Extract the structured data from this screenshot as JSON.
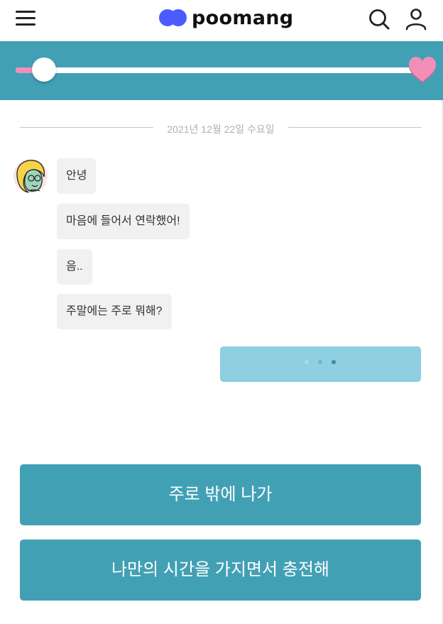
{
  "header": {
    "logo_text": "poomang",
    "logo_color": "#4a5cff",
    "menu_icon": "hamburger-menu-icon",
    "search_icon": "search-icon",
    "user_icon": "user-icon"
  },
  "progress": {
    "value": 0.07,
    "track_color": "#ffffff",
    "fill_color": "#f28eb8",
    "band_color": "#42a0b5",
    "end_icon": "heart-icon"
  },
  "chat": {
    "date": "2021년 12월 22일 수요일",
    "messages": [
      {
        "text": "안녕"
      },
      {
        "text": "마음에 들어서 연락했어!"
      },
      {
        "text": "음.."
      },
      {
        "text": "주말에는 주로 뭐해?"
      }
    ],
    "typing_indicator": {
      "dots": 3,
      "color": "#8ecfe1"
    }
  },
  "answers": [
    {
      "label": "주로 밖에 나가"
    },
    {
      "label": "나만의 시간을 가지면서 충전해"
    }
  ],
  "colors": {
    "accent": "#42a0b5",
    "bubble_bg": "#f1f1f1",
    "heart": "#f28eb8"
  }
}
